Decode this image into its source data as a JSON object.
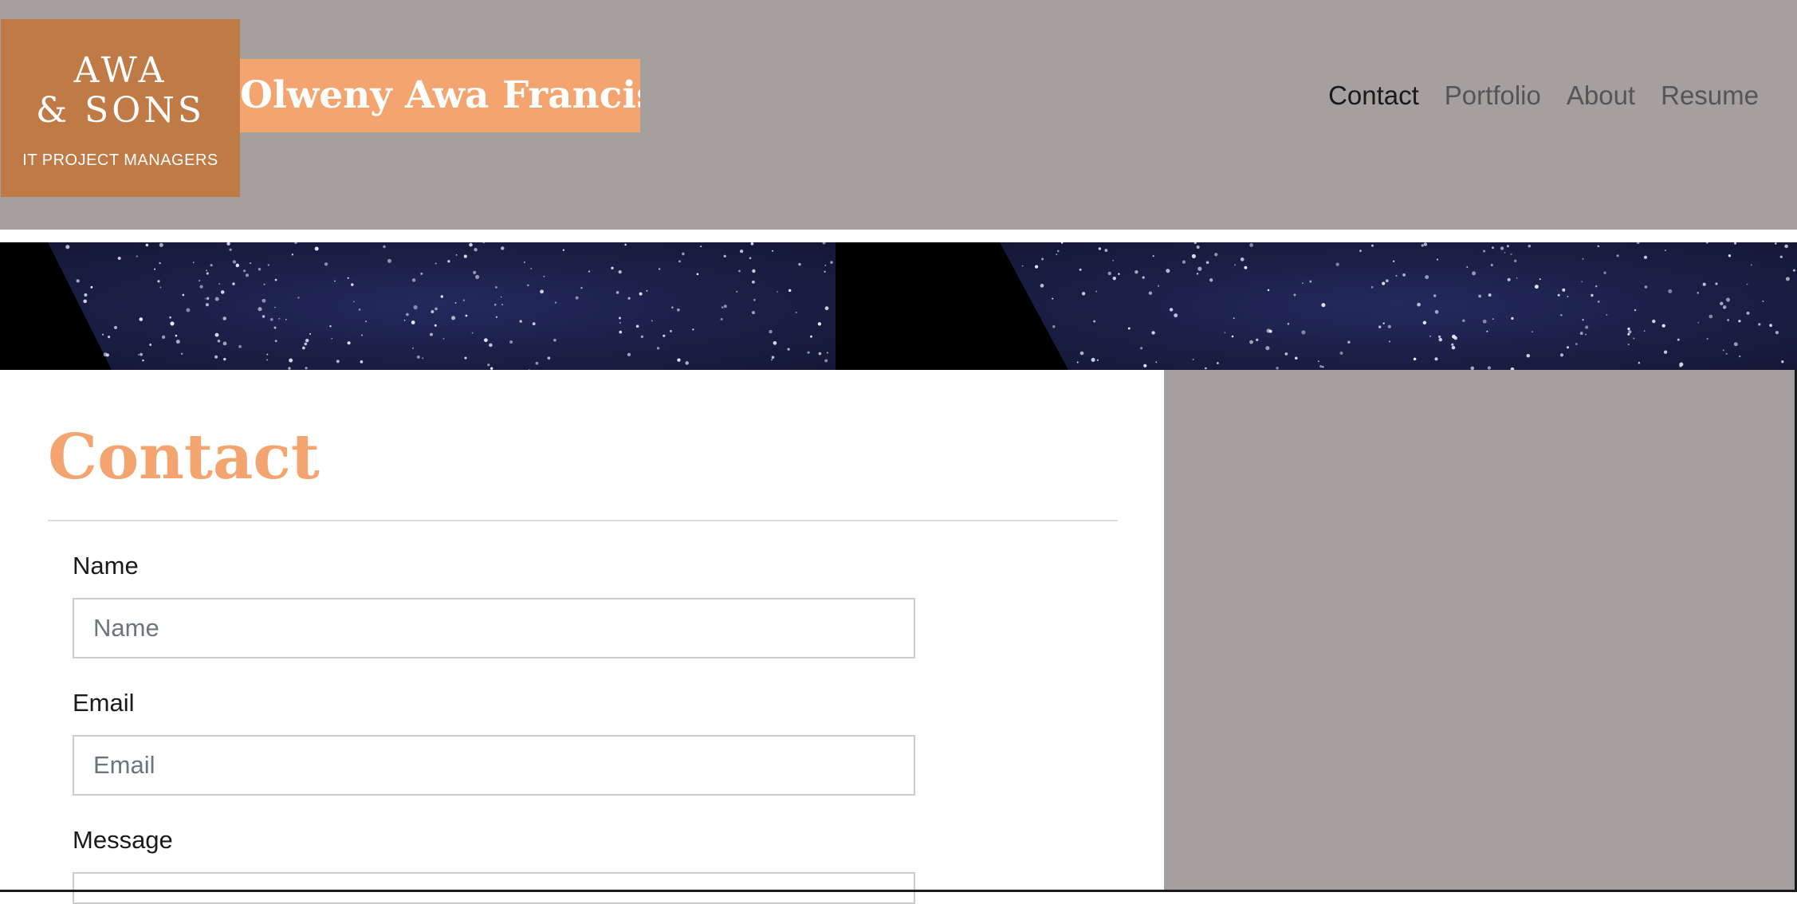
{
  "header": {
    "logo": {
      "line1": "AWA",
      "line2": "& SONS",
      "tagline": "IT PROJECT MANAGERS"
    },
    "site_title": "Olweny Awa Francis",
    "nav": [
      {
        "label": "Contact",
        "active": true
      },
      {
        "label": "Portfolio",
        "active": false
      },
      {
        "label": "About",
        "active": false
      },
      {
        "label": "Resume",
        "active": false
      }
    ]
  },
  "banner": {
    "image": "starry-night-sky"
  },
  "main": {
    "title": "Contact",
    "form": {
      "name_label": "Name",
      "name_placeholder": "Name",
      "email_label": "Email",
      "email_placeholder": "Email",
      "message_label": "Message"
    }
  },
  "colors": {
    "header_bg": "#a59f9f",
    "accent": "#f4a46f",
    "logo_bg": "#bf7a45",
    "banner_sky": "#1b1f4a"
  }
}
